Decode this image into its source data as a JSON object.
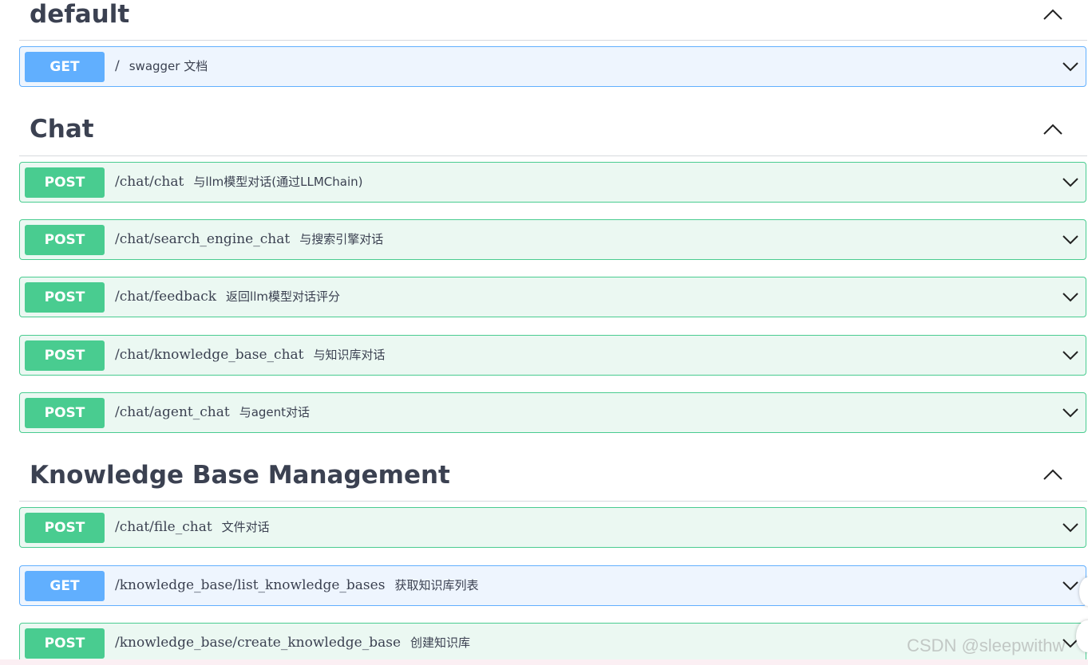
{
  "sections": [
    {
      "title": "default",
      "operations": [
        {
          "method": "GET",
          "path": "/",
          "summary": "swagger 文档"
        }
      ]
    },
    {
      "title": "Chat",
      "operations": [
        {
          "method": "POST",
          "path": "/chat/chat",
          "summary": "与llm模型对话(通过LLMChain)"
        },
        {
          "method": "POST",
          "path": "/chat/search_engine_chat",
          "summary": "与搜索引擎对话"
        },
        {
          "method": "POST",
          "path": "/chat/feedback",
          "summary": "返回llm模型对话评分"
        },
        {
          "method": "POST",
          "path": "/chat/knowledge_base_chat",
          "summary": "与知识库对话"
        },
        {
          "method": "POST",
          "path": "/chat/agent_chat",
          "summary": "与agent对话"
        }
      ]
    },
    {
      "title": "Knowledge Base Management",
      "operations": [
        {
          "method": "POST",
          "path": "/chat/file_chat",
          "summary": "文件对话"
        },
        {
          "method": "GET",
          "path": "/knowledge_base/list_knowledge_bases",
          "summary": "获取知识库列表"
        },
        {
          "method": "POST",
          "path": "/knowledge_base/create_knowledge_base",
          "summary": "创建知识库"
        }
      ]
    }
  ],
  "watermark": "CSDN @sleepwithw",
  "icons": {
    "collapse": "chevron-up-icon",
    "expand": "chevron-down-icon"
  },
  "colors": {
    "post": "#49cc90",
    "get": "#61affe",
    "text": "#3b4151"
  }
}
